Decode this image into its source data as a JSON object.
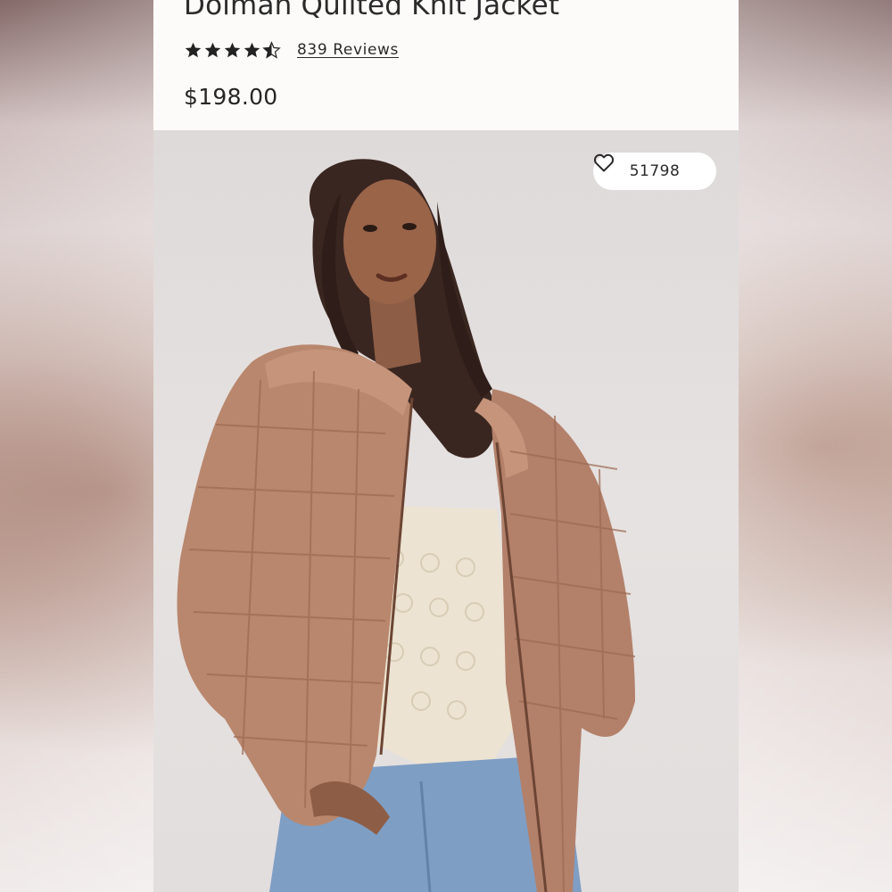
{
  "product": {
    "title": "Dolman Quilted Knit Jacket",
    "rating": 4.5,
    "reviews_label": "839 Reviews",
    "price": "$198.00"
  },
  "image": {
    "alt": "Model wearing a tan quilted knit jacket over a cream lace top and blue jeans",
    "favorites_count": "51798",
    "favorite_icon": "heart-outline-icon"
  },
  "colors": {
    "text": "#2b2b2b",
    "jacket": "#b9876d",
    "background": "#e3dfde"
  }
}
